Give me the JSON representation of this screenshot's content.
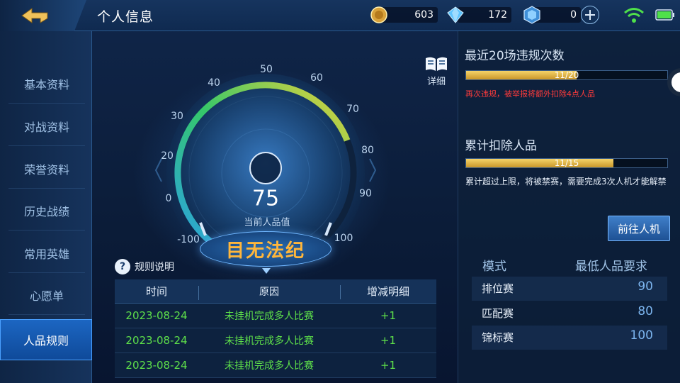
{
  "header": {
    "title": "个人信息",
    "resources": [
      {
        "icon": "gold-coin-icon",
        "value": "603"
      },
      {
        "icon": "diamond-icon",
        "value": "172"
      },
      {
        "icon": "crystal-coupon-icon",
        "value": "0"
      }
    ],
    "status": {
      "wifi": "wifi-icon",
      "battery": "battery-icon"
    }
  },
  "sidebar": {
    "items": [
      {
        "label": "基本资料"
      },
      {
        "label": "对战资料"
      },
      {
        "label": "荣誉资料"
      },
      {
        "label": "历史战绩"
      },
      {
        "label": "常用英雄"
      },
      {
        "label": "心愿单"
      },
      {
        "label": "人品规则",
        "active": true
      }
    ]
  },
  "gauge": {
    "score": "75",
    "score_label": "当前人品值",
    "ticks": [
      "-100",
      "0",
      "20",
      "30",
      "40",
      "50",
      "60",
      "70",
      "80",
      "90",
      "100"
    ],
    "rank_title": "目无法纪",
    "fraction": 0.72
  },
  "detail": {
    "label": "详细"
  },
  "rules": {
    "label": "规则说明"
  },
  "table": {
    "headers": [
      "时间",
      "原因",
      "增减明细"
    ],
    "rows": [
      [
        "2023-08-24",
        "未挂机完成多人比赛",
        "+1"
      ],
      [
        "2023-08-24",
        "未挂机完成多人比赛",
        "+1"
      ],
      [
        "2023-08-24",
        "未挂机完成多人比赛",
        "+1"
      ]
    ]
  },
  "right": {
    "violations_title": "最近20场违规次数",
    "violations_text": "11/20",
    "violations_fraction": 0.55,
    "warning": "再次违规，被举报将额外扣除4点人品",
    "deduct_title": "累计扣除人品",
    "deduct_text": "11/15",
    "deduct_fraction": 0.733,
    "deduct_note": "累计超过上限，将被禁赛，需要完成3次人机才能解禁",
    "go_button": "前往人机",
    "modes_headers": [
      "模式",
      "最低人品要求"
    ],
    "modes": [
      {
        "mode": "排位赛",
        "min": "90"
      },
      {
        "mode": "匹配赛",
        "min": "80"
      },
      {
        "mode": "锦标赛",
        "min": "100"
      }
    ]
  },
  "colors": {
    "accent_blue": "#1c66c2",
    "gold": "#e6b84a",
    "warning_red": "#ff3b3b",
    "positive_green": "#5ee04a",
    "banner_text": "#ffb63b"
  }
}
